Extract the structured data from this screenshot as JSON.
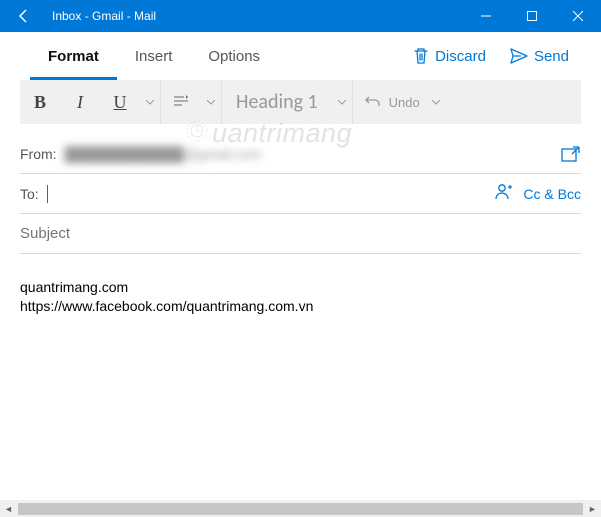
{
  "window": {
    "title": "Inbox - Gmail - Mail"
  },
  "tabs": {
    "format": "Format",
    "insert": "Insert",
    "options": "Options"
  },
  "actions": {
    "discard": "Discard",
    "send": "Send"
  },
  "toolbar": {
    "bold": "B",
    "italic": "I",
    "underline": "U",
    "style_label": "Heading 1",
    "undo_label": "Undo"
  },
  "fields": {
    "from_label": "From:",
    "from_value": "████████████@gmail.com",
    "to_label": "To:",
    "cc_bcc": "Cc & Bcc",
    "subject_placeholder": "Subject"
  },
  "body": {
    "line1": "quantrimang.com",
    "line2": "https://www.facebook.com/quantrimang.com.vn"
  },
  "watermark": "uantrimang"
}
